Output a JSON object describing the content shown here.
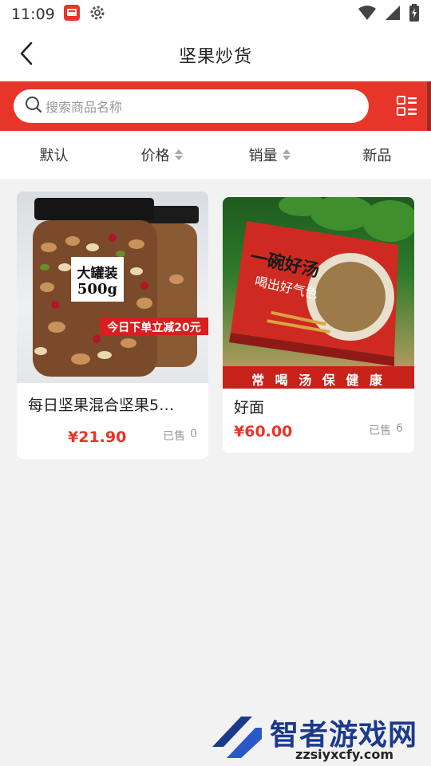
{
  "status_bar": {
    "time": "11:09",
    "icons_left": [
      "notification-app-icon",
      "settings-gear-icon"
    ],
    "icons_right": [
      "wifi-icon",
      "signal-icon",
      "battery-charging-icon"
    ]
  },
  "header": {
    "back_icon": "chevron-left-icon",
    "title": "坚果炒货"
  },
  "search": {
    "placeholder": "搜索商品名称",
    "layout_toggle_icon": "list-layout-icon"
  },
  "sort_tabs": [
    {
      "label": "默认",
      "sortable": false
    },
    {
      "label": "价格",
      "sortable": true
    },
    {
      "label": "销量",
      "sortable": true
    },
    {
      "label": "新品",
      "sortable": false
    }
  ],
  "products": [
    {
      "name": "每日坚果混合坚果5…",
      "price": "¥21.90",
      "sold_label": "已售",
      "sold_count": "0",
      "image": {
        "badge_line1": "大罐装",
        "badge_line2": "500g",
        "promo": "今日下单立减20元"
      }
    },
    {
      "name": "好面",
      "price": "¥60.00",
      "sold_label": "已售",
      "sold_count": "6",
      "image": {
        "box_title": "一碗好汤",
        "box_subtitle": "喝出好气色",
        "banner": "常 喝 汤 保 健 康"
      }
    }
  ],
  "watermark": {
    "text": "智者游戏网",
    "url": "zzsiyxcfy.com"
  },
  "colors": {
    "accent": "#e8352a",
    "price": "#e8352a",
    "watermark": "#1c3a8c"
  }
}
